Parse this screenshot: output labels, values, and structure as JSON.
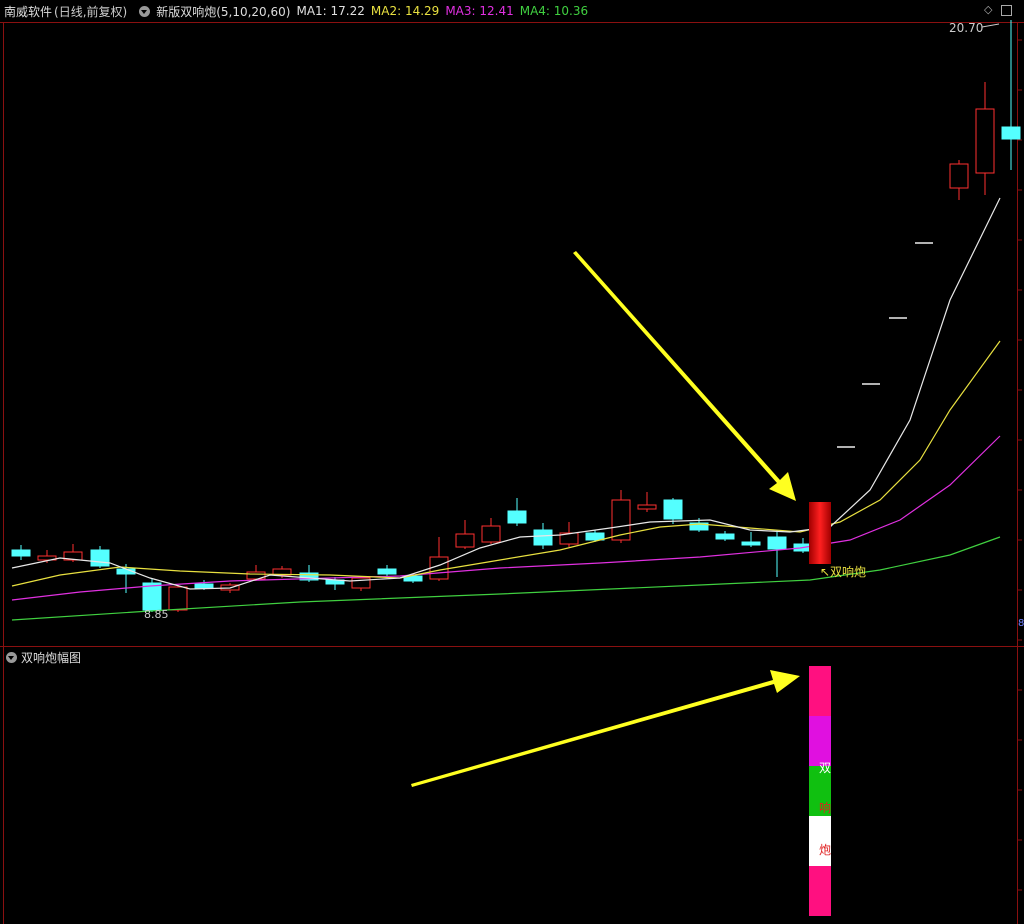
{
  "header": {
    "app_title": "南威软件",
    "mode": "(日线,前复权)",
    "indicator": "新版双响炮(5,10,20,60)",
    "ma": [
      {
        "label": "MA1: 17.22",
        "color": "#e0e0e0"
      },
      {
        "label": "MA2: 14.29",
        "color": "#e8e040"
      },
      {
        "label": "MA3: 12.41",
        "color": "#e030e0"
      },
      {
        "label": "MA4: 10.36",
        "color": "#40d040"
      }
    ]
  },
  "main_chart": {
    "high_label": "20.70",
    "low_label": "8.85",
    "signal_label": "↖双响炮",
    "right_axis_label": "8",
    "colors": {
      "up": "#ff3030",
      "down": "#54ffff",
      "signal": "#e01010",
      "arrow": "#ffff20"
    }
  },
  "sub_chart": {
    "title": "双响炮幅图",
    "bar_text": [
      "双",
      "响",
      "炮"
    ],
    "bar_colors": [
      "#ff1080",
      "#e010e0",
      "#10c010",
      "#ffffff",
      "#ff1080"
    ]
  }
}
